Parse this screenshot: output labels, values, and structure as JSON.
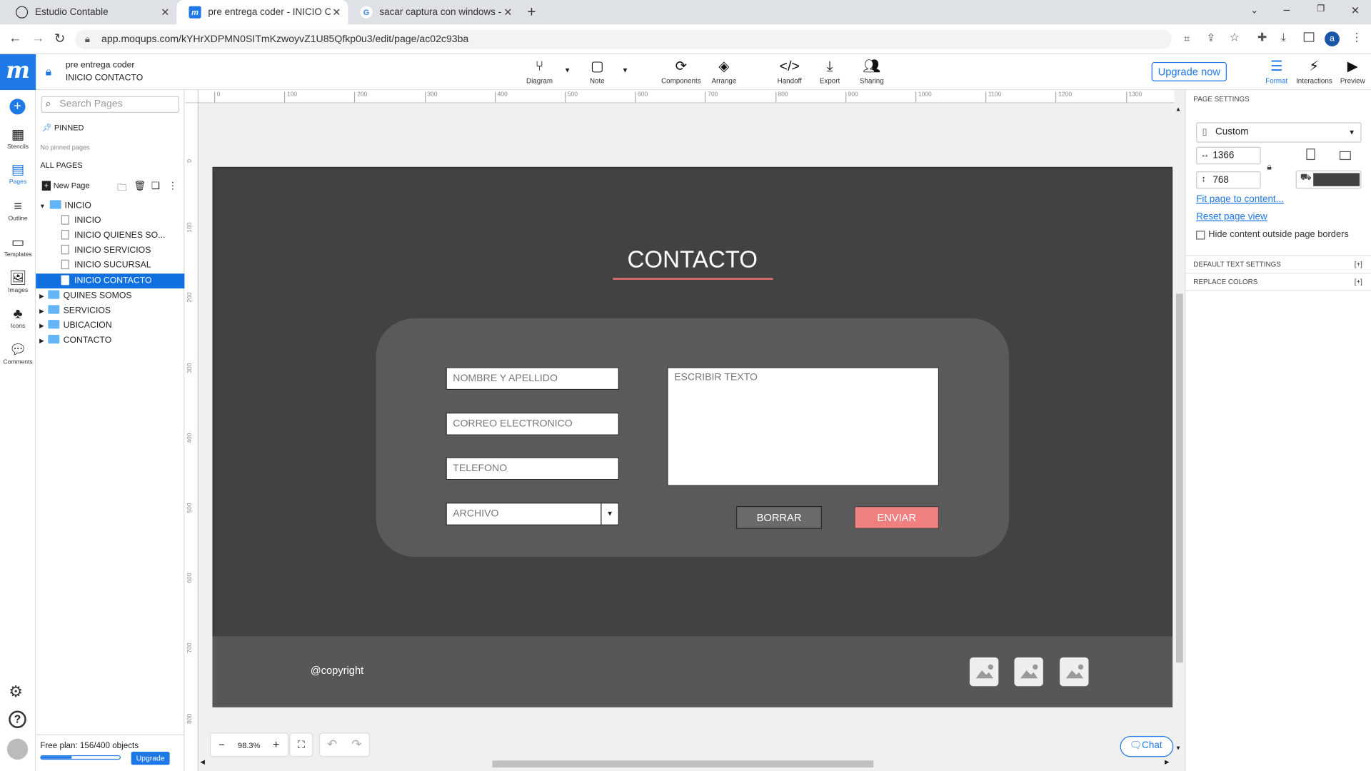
{
  "browser": {
    "tabs": [
      {
        "label": "Estudio Contable"
      },
      {
        "label": "pre entrega coder - INICIO CON"
      },
      {
        "label": "sacar captura con windows - Bus"
      }
    ],
    "url": "app.moqups.com/kYHrXDPMN0SITmKzwoyvZ1U85Qfkp0u3/edit/page/ac02c93ba",
    "profile_initial": "a"
  },
  "app": {
    "logo": "m",
    "project_name": "pre entrega coder",
    "page_name": "INICIO CONTACTO",
    "toolbar": {
      "diagram": "Diagram",
      "note": "Note",
      "components": "Components",
      "arrange": "Arrange",
      "handoff": "Handoff",
      "export": "Export",
      "sharing": "Sharing",
      "upgrade": "Upgrade now",
      "format": "Format",
      "interactions": "Interactions",
      "preview": "Preview"
    },
    "rail": [
      "Stencils",
      "Pages",
      "Outline",
      "Templates",
      "Images",
      "Icons",
      "Comments"
    ]
  },
  "pages_panel": {
    "search_placeholder": "Search Pages",
    "pinned_label": "PINNED",
    "no_pinned": "No pinned pages",
    "all_pages_label": "ALL PAGES",
    "new_page": "New Page",
    "tree": [
      {
        "label": "INICIO",
        "kind": "folder",
        "open": true
      },
      {
        "label": "INICIO",
        "kind": "page"
      },
      {
        "label": "INICIO QUIENES SO...",
        "kind": "page"
      },
      {
        "label": "INICIO SERVICIOS",
        "kind": "page"
      },
      {
        "label": "INICIO SUCURSAL",
        "kind": "page"
      },
      {
        "label": "INICIO CONTACTO",
        "kind": "page",
        "selected": true
      },
      {
        "label": "QUINES SOMOS",
        "kind": "folder"
      },
      {
        "label": "SERVICIOS",
        "kind": "folder"
      },
      {
        "label": "UBICACION",
        "kind": "folder"
      },
      {
        "label": "CONTACTO",
        "kind": "folder"
      }
    ],
    "plan_text": "Free plan: 156/400 objects",
    "plan_used_fraction": 0.39,
    "upgrade_btn": "Upgrade"
  },
  "ruler": {
    "h_ticks": [
      "0",
      "100",
      "200",
      "300",
      "400",
      "500",
      "600",
      "700",
      "800",
      "900",
      "1000",
      "1100",
      "1200",
      "1300"
    ],
    "v_ticks": [
      "0",
      "100",
      "200",
      "300",
      "400",
      "500",
      "600",
      "700",
      "800"
    ]
  },
  "mockup": {
    "title": "CONTACTO",
    "fields": {
      "name": "NOMBRE Y APELLIDO",
      "email": "CORREO ELECTRONICO",
      "phone": "TELEFONO",
      "file": "ARCHIVO",
      "message": "ESCRIBIR TEXTO"
    },
    "btn_clear": "BORRAR",
    "btn_send": "ENVIAR",
    "copyright": "@copyright"
  },
  "canvas_controls": {
    "zoom": "98.3%",
    "chat": "Chat"
  },
  "page_settings": {
    "header": "PAGE SETTINGS",
    "preset": "Custom",
    "width": "1366",
    "height": "768",
    "fill_color": "#424242",
    "fit_link": "Fit page to content...",
    "reset_link": "Reset page view",
    "hide_label": "Hide content outside page borders",
    "default_text": "DEFAULT TEXT SETTINGS",
    "replace_colors": "REPLACE COLORS",
    "expand": "[+]"
  },
  "colors": {
    "accent": "#1e78e6",
    "send_button": "#f08080",
    "title_underline": "#e57373"
  }
}
